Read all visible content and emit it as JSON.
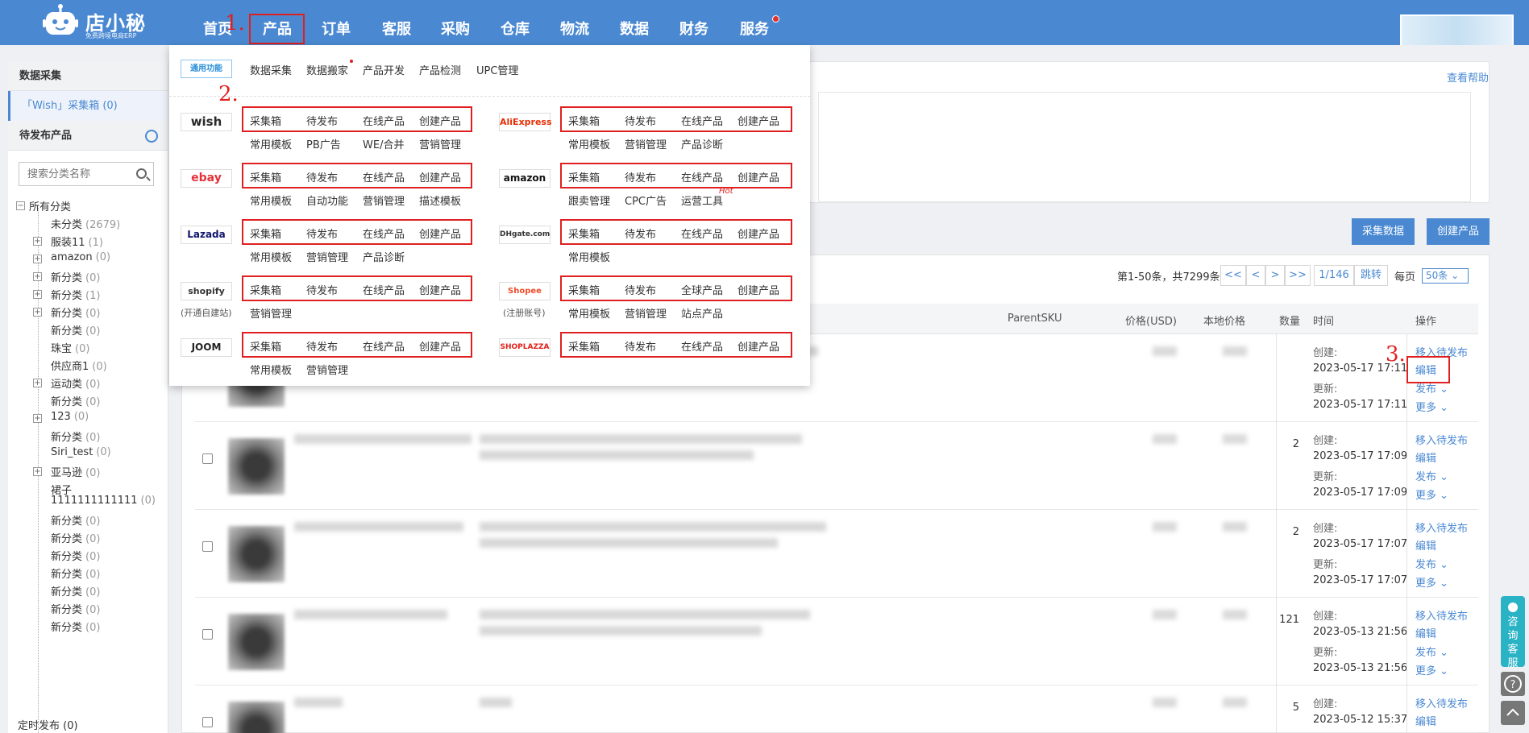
{
  "app": {
    "brand": "店小秘",
    "brand_sub": "免费跨境电商ERP"
  },
  "nav": [
    "首页",
    "产品",
    "订单",
    "客服",
    "采购",
    "仓库",
    "物流",
    "数据",
    "财务",
    "服务"
  ],
  "annotations": [
    "1.",
    "2.",
    "3."
  ],
  "sidebar": {
    "section1": "数据采集",
    "selected_item": "「Wish」采集箱 (0)",
    "section2": "待发布产品",
    "search_placeholder": "搜索分类名称",
    "tree": [
      {
        "name": "所有分类",
        "count": "",
        "type": "minus"
      },
      {
        "name": "未分类",
        "count": "(2679)",
        "type": "leaf"
      },
      {
        "name": "服装11",
        "count": "(1)",
        "type": "plus"
      },
      {
        "name": "amazon",
        "count": "(0)",
        "type": "plus"
      },
      {
        "name": "新分类",
        "count": "(0)",
        "type": "plus"
      },
      {
        "name": "新分类",
        "count": "(1)",
        "type": "plus"
      },
      {
        "name": "新分类",
        "count": "(0)",
        "type": "plus"
      },
      {
        "name": "新分类",
        "count": "(0)",
        "type": "leaf"
      },
      {
        "name": "珠宝",
        "count": "(0)",
        "type": "leaf"
      },
      {
        "name": "供应商1",
        "count": "(0)",
        "type": "leaf"
      },
      {
        "name": "运动类",
        "count": "(0)",
        "type": "plus"
      },
      {
        "name": "新分类",
        "count": "(0)",
        "type": "leaf"
      },
      {
        "name": "123",
        "count": "(0)",
        "type": "plus"
      },
      {
        "name": "新分类",
        "count": "(0)",
        "type": "leaf"
      },
      {
        "name": "Siri_test",
        "count": "(0)",
        "type": "leaf"
      },
      {
        "name": "亚马逊",
        "count": "(0)",
        "type": "plus"
      },
      {
        "name": "裙子",
        "count": "",
        "type": "leaf"
      },
      {
        "name": "1111111111111",
        "count": "(0)",
        "type": "cont"
      },
      {
        "name": "新分类",
        "count": "(0)",
        "type": "leaf"
      },
      {
        "name": "新分类",
        "count": "(0)",
        "type": "leaf"
      },
      {
        "name": "新分类",
        "count": "(0)",
        "type": "leaf"
      },
      {
        "name": "新分类",
        "count": "(0)",
        "type": "leaf"
      },
      {
        "name": "新分类",
        "count": "(0)",
        "type": "leaf"
      },
      {
        "name": "新分类",
        "count": "(0)",
        "type": "leaf"
      },
      {
        "name": "新分类",
        "count": "(0)",
        "type": "leaf"
      }
    ],
    "timed_publish": "定时发布 (0)"
  },
  "main": {
    "help": "查看帮助",
    "btn_collect": "采集数据",
    "btn_create": "创建产品",
    "pager_info": "第1-50条，共7299条",
    "pager_buttons": [
      "<<",
      "<",
      ">",
      ">>",
      "1/146",
      "跳转"
    ],
    "per_page_label": "每页",
    "per_page_value": "50条",
    "columns": [
      "ParentSKU",
      "价格(USD)",
      "本地价格",
      "数量",
      "时间",
      "操作"
    ],
    "rows": [
      {
        "qty": "",
        "created": "2023-05-17 17:11",
        "updated": "2023-05-17 17:11"
      },
      {
        "qty": "2",
        "created": "2023-05-17 17:09",
        "updated": "2023-05-17 17:09"
      },
      {
        "qty": "2",
        "created": "2023-05-17 17:07",
        "updated": "2023-05-17 17:07"
      },
      {
        "qty": "121",
        "created": "2023-05-13 21:56",
        "updated": "2023-05-13 21:56"
      },
      {
        "qty": "5",
        "created": "2023-05-12 15:37",
        "updated": ""
      }
    ],
    "labels": {
      "created": "创建:",
      "updated": "更新:"
    },
    "ops": {
      "move": "移入待发布",
      "edit": "编辑",
      "publish": "发布",
      "more": "更多"
    }
  },
  "dropdown": {
    "common_badge": "通用功能",
    "common_links": [
      "数据采集",
      "数据搬家",
      "产品开发",
      "产品检测",
      "UPC管理"
    ],
    "left": [
      {
        "platform": "wish",
        "main": [
          "采集箱",
          "待发布",
          "在线产品",
          "创建产品"
        ],
        "sub": [
          "常用模板",
          "PB广告",
          "WE/合并",
          "营销管理"
        ],
        "note": ""
      },
      {
        "platform": "ebay",
        "main": [
          "采集箱",
          "待发布",
          "在线产品",
          "创建产品"
        ],
        "sub": [
          "常用模板",
          "自动功能",
          "营销管理",
          "描述模板"
        ],
        "note": ""
      },
      {
        "platform": "Lazada",
        "main": [
          "采集箱",
          "待发布",
          "在线产品",
          "创建产品"
        ],
        "sub": [
          "常用模板",
          "营销管理",
          "产品诊断"
        ],
        "note": ""
      },
      {
        "platform": "shopify",
        "main": [
          "采集箱",
          "待发布",
          "在线产品",
          "创建产品"
        ],
        "sub": [
          "营销管理"
        ],
        "note": "(开通自建站)"
      },
      {
        "platform": "JOOM",
        "main": [
          "采集箱",
          "待发布",
          "在线产品",
          "创建产品"
        ],
        "sub": [
          "常用模板",
          "营销管理"
        ],
        "note": ""
      }
    ],
    "right": [
      {
        "platform": "AliExpress",
        "main": [
          "采集箱",
          "待发布",
          "在线产品",
          "创建产品"
        ],
        "sub": [
          "常用模板",
          "营销管理",
          "产品诊断"
        ],
        "note": ""
      },
      {
        "platform": "amazon",
        "main": [
          "采集箱",
          "待发布",
          "在线产品",
          "创建产品"
        ],
        "sub": [
          "跟卖管理",
          "CPC广告",
          "运营工具"
        ],
        "note": ""
      },
      {
        "platform": "DHgate.com",
        "main": [
          "采集箱",
          "待发布",
          "在线产品",
          "创建产品"
        ],
        "sub": [
          "常用模板"
        ],
        "note": ""
      },
      {
        "platform": "Shopee",
        "main": [
          "采集箱",
          "待发布",
          "全球产品",
          "创建产品"
        ],
        "sub": [
          "常用模板",
          "营销管理",
          "站点产品"
        ],
        "note": "(注册账号)"
      },
      {
        "platform": "SHOPLAZZA",
        "main": [
          "采集箱",
          "待发布",
          "在线产品",
          "创建产品"
        ],
        "sub": [],
        "note": ""
      }
    ],
    "hot": "Hot"
  },
  "float": {
    "cs": [
      "咨",
      "询",
      "客",
      "服"
    ]
  },
  "colors": {
    "brand": "#4a89d2",
    "annotation": "#e02020",
    "cs": "#2ab3c5"
  }
}
